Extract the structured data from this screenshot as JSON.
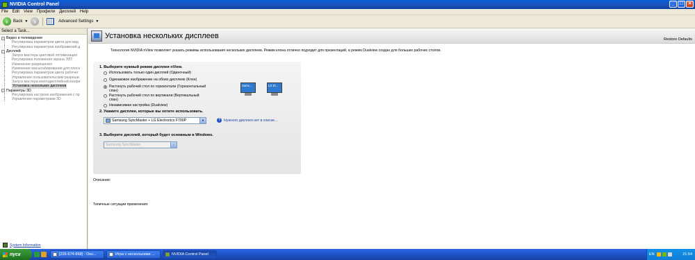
{
  "window": {
    "title": "NVIDIA Control Panel",
    "controls": [
      "_",
      "□",
      "×"
    ]
  },
  "menu": [
    "File",
    "Edit",
    "View",
    "Профили",
    "Дисплей",
    "Help"
  ],
  "toolbar": {
    "back_label": "Back",
    "advanced_label": "Advanced Settings"
  },
  "sidebar": {
    "task_label": "Select a Task...",
    "groups": [
      {
        "label": "Видео и телевидение",
        "items": [
          "Регулировка параметров цвета для вид",
          "Регулировка параметров изображений д"
        ]
      },
      {
        "label": "Дисплей",
        "items": [
          "Запуск мастера цветовой оптимизации",
          "Регулировка положения экрана ЭЛТ",
          "Изменение разрешения",
          "Изменение масштабирования для плоск",
          "Регулировка параметров цвета рабочег",
          "Управление пользовательским разреши",
          "Запуск мастера многодисплейной конфи",
          "Установка нескольких дисплеев"
        ],
        "selected": 7
      },
      {
        "label": "Параметры 3D",
        "items": [
          "Регулировка настроек изображения с пр",
          "Управление параметрами 3D"
        ]
      }
    ],
    "system_info": "System Information"
  },
  "content": {
    "title": "Установка нескольких дисплеев",
    "restore": "Restore Defaults",
    "intro": "Технология NVIDIA nView позволяет указать режимы использования нескольких дисплеев. Режим клона отлично подходит для презентаций, а режим Dualview создан для больших рабочих столов.",
    "step1": {
      "title": "1. Выберите нужный режим дисплея nView.",
      "options": [
        "Использовать только один дисплей (Одиночный)",
        "Одинаковое изображение на обоих дисплеях (Клон)",
        "Растянуть рабочий стол по горизонтали (Горизонтальный спан)",
        "Растянуть рабочий стол по вертикали (Вертикальный спан)",
        "Независимая настройка (Dualview)"
      ],
      "selected": 2,
      "monitors": [
        "Sams...",
        "LG El..."
      ]
    },
    "step2": {
      "title": "2. Укажите дисплеи, которые вы хотите использовать.",
      "value": "Samsung SyncMaster + LG Electronics F700P",
      "help": "Нужного дисплея нет в списке..."
    },
    "step3": {
      "title": "3. Выберите дисплей, который будет основным в Windows.",
      "value": "Samsung SyncMaster"
    },
    "description_label": "Описание:",
    "typical_label": "Типичные ситуации применения:"
  },
  "taskbar": {
    "start": "пуск",
    "buttons": [
      "[226-674-868] - Окн...",
      "Игра с несколькими ...",
      "NVIDIA Control Panel"
    ],
    "active": 2,
    "lang": "EN",
    "clock": "21:54"
  },
  "colors": {
    "title_bar": "#1f4fb8",
    "taskbar": "#245edb",
    "start": "#2d8a2d",
    "nvidia_green": "#76b900"
  }
}
